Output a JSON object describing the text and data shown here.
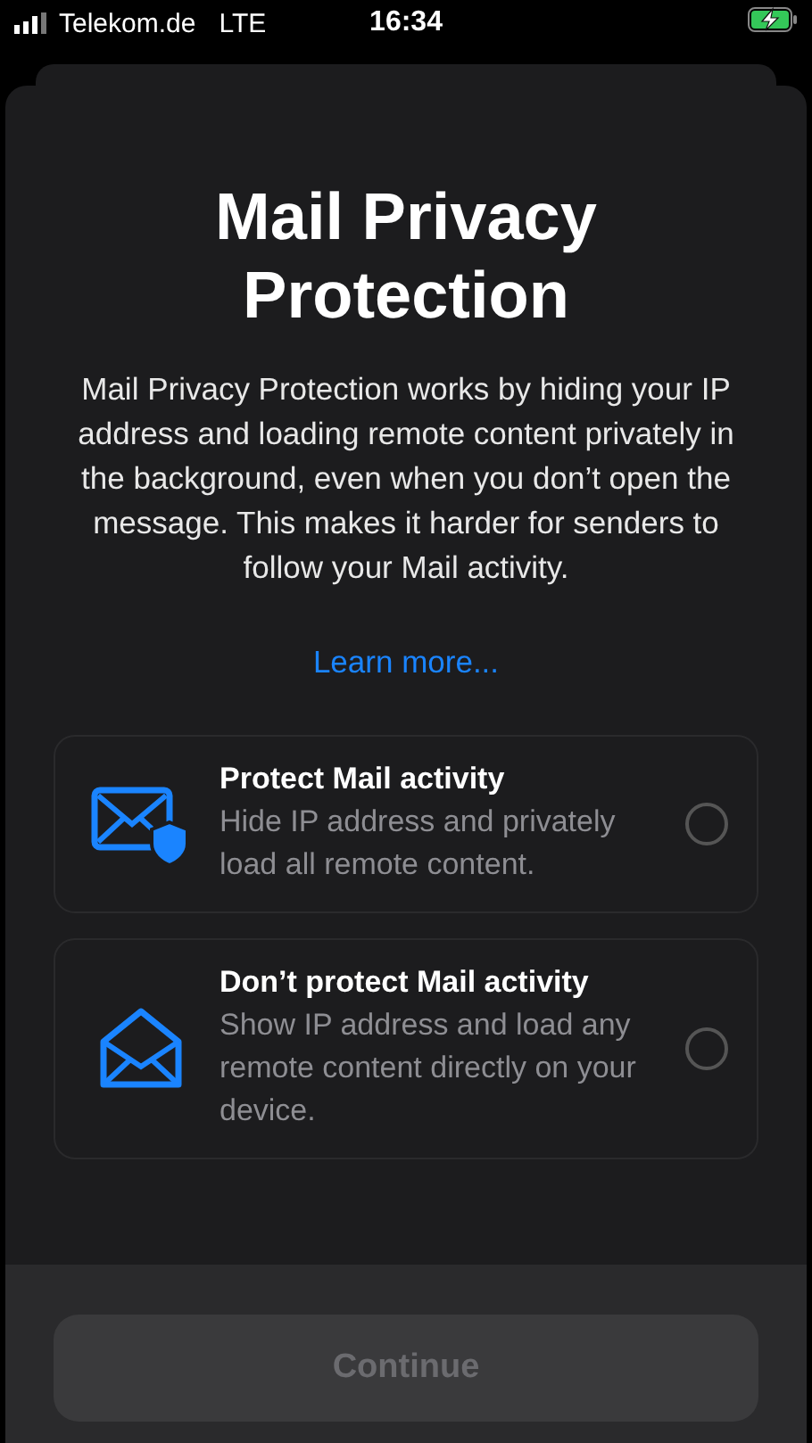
{
  "status_bar": {
    "carrier": "Telekom.de",
    "network": "LTE",
    "time": "16:34",
    "charging": true
  },
  "title": "Mail Privacy Protection",
  "description": "Mail Privacy Protection works by hiding your IP address and loading remote content privately in the background, even when you don’t open the message. This makes it harder for senders to follow your Mail activity.",
  "link": "Learn more...",
  "options": [
    {
      "kind": "shield",
      "title": "Protect Mail activity",
      "subtitle": "Hide IP address and privately load all remote content.",
      "selected": false
    },
    {
      "kind": "open",
      "title": "Don’t protect Mail activity",
      "subtitle": "Show IP address and load any remote content directly on your device.",
      "selected": false
    }
  ],
  "button": {
    "label": "Continue",
    "disabled": true
  }
}
